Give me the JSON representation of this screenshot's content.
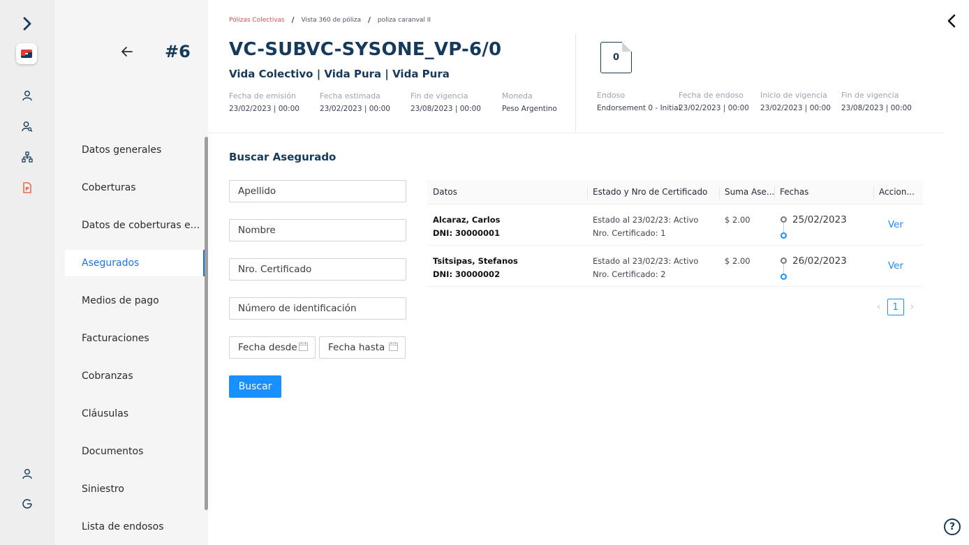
{
  "colors": {
    "brand": "#163a5c",
    "accent": "#1890ff",
    "logo_red": "#e53935"
  },
  "sidebar": {
    "order_number": "#6",
    "items": [
      {
        "label": "Datos generales"
      },
      {
        "label": "Coberturas"
      },
      {
        "label": "Datos de coberturas e..."
      },
      {
        "label": "Asegurados",
        "active": true
      },
      {
        "label": "Medios de pago"
      },
      {
        "label": "Facturaciones"
      },
      {
        "label": "Cobranzas"
      },
      {
        "label": "Cláusulas"
      },
      {
        "label": "Documentos"
      },
      {
        "label": "Siniestro"
      },
      {
        "label": "Lista de endosos"
      }
    ]
  },
  "breadcrumb": [
    "Pólizas Colectivas",
    "Vista 360 de póliza",
    "poliza caranval II"
  ],
  "header": {
    "title": "VC-SUBVC-SYSONE_VP-6/0",
    "subtitle": "Vida Colectivo | Vida Pura | Vida Pura",
    "meta": [
      {
        "label": "Fecha de emisión",
        "value": "23/02/2023 | 00:00"
      },
      {
        "label": "Fecha estimada",
        "value": "23/02/2023 | 00:00"
      },
      {
        "label": "Fin de vigencia",
        "value": "23/08/2023 | 00:00"
      },
      {
        "label": "Moneda",
        "value": "Peso Argentino"
      }
    ],
    "doc_count": "0",
    "endorsement_meta": [
      {
        "label": "Endoso",
        "value": "Endorsement 0 - Initial"
      },
      {
        "label": "Fecha de endoso",
        "value": "23/02/2023 | 00:00"
      },
      {
        "label": "Inicio de vigencia",
        "value": "23/02/2023 | 00:00"
      },
      {
        "label": "Fin de vigencia",
        "value": "23/08/2023 | 00:00"
      }
    ]
  },
  "search": {
    "title": "Buscar Asegurado",
    "apellido": "Apellido",
    "nombre": "Nombre",
    "certificado": "Nro. Certificado",
    "identificacion": "Número de identificación",
    "fecha_desde": "Fecha desde",
    "fecha_hasta": "Fecha hasta",
    "button": "Buscar"
  },
  "table": {
    "columns": [
      "Datos",
      "Estado y Nro de Certificado",
      "Suma Ase...",
      "Fechas",
      "Accion..."
    ],
    "rows": [
      {
        "name": "Alcaraz, Carlos",
        "dni": "DNI: 30000001",
        "estado": "Estado al 23/02/23: Activo",
        "cert": "Nro. Certificado: 1",
        "suma": "$ 2.00",
        "fecha": "25/02/2023",
        "action": "Ver"
      },
      {
        "name": "Tsitsipas, Stefanos",
        "dni": "DNI: 30000002",
        "estado": "Estado al 23/02/23: Activo",
        "cert": "Nro. Certificado: 2",
        "suma": "$ 2.00",
        "fecha": "26/02/2023",
        "action": "Ver"
      }
    ]
  },
  "pagination": {
    "current": "1"
  },
  "help": "?"
}
